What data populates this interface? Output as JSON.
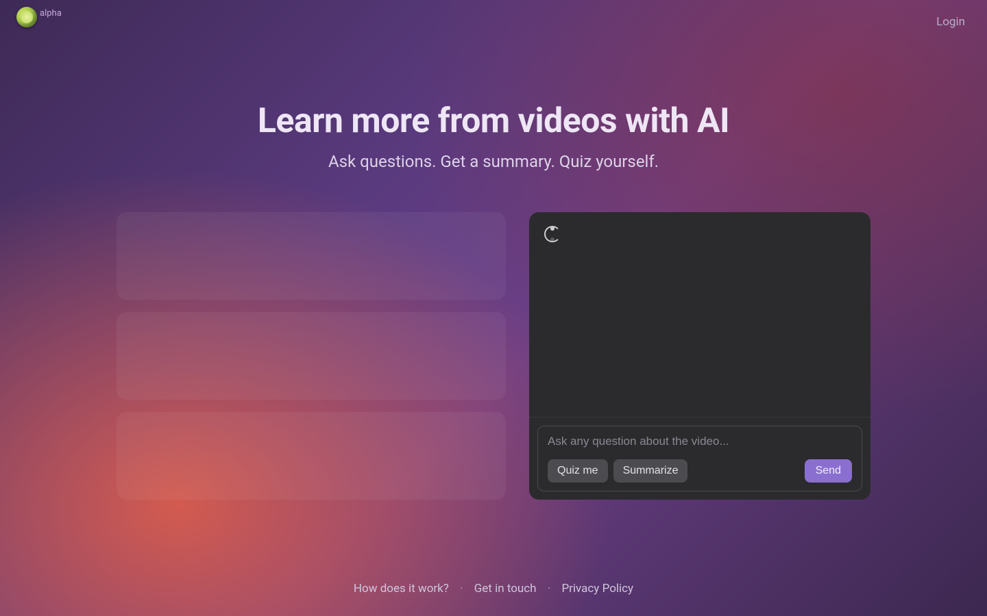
{
  "header": {
    "alpha_tag": "alpha",
    "login": "Login"
  },
  "hero": {
    "title": "Learn more from videos with AI",
    "subtitle": "Ask questions. Get a summary. Quiz yourself."
  },
  "chat": {
    "input_placeholder": "Ask any question about the video...",
    "quiz_label": "Quiz me",
    "summarize_label": "Summarize",
    "send_label": "Send"
  },
  "footer": {
    "how": "How does it work?",
    "contact": "Get in touch",
    "privacy": "Privacy Policy",
    "separator": "·"
  }
}
